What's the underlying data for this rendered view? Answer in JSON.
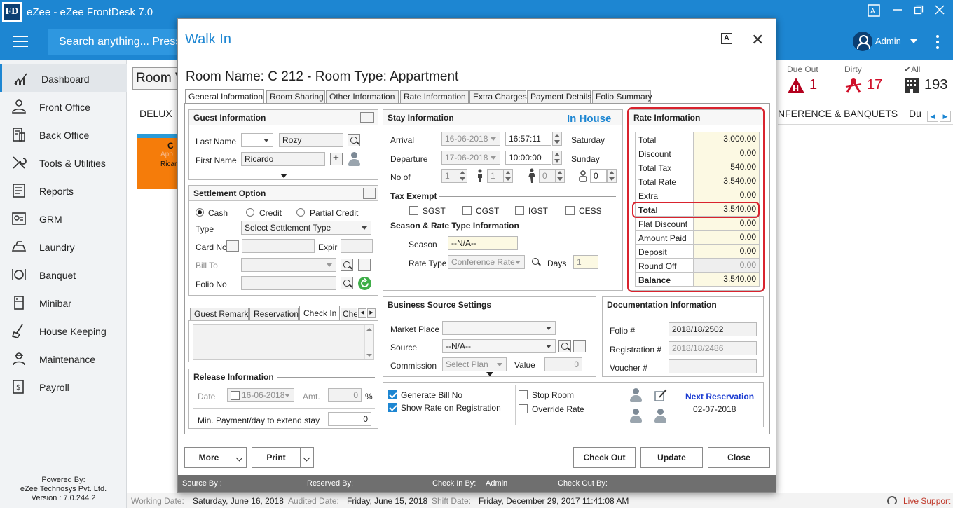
{
  "app": {
    "logo_text": "FD",
    "title": "eZee - eZee FrontDesk 7.0",
    "search_placeholder": "Search anything... Press",
    "user_name": "Admin"
  },
  "sidebar": {
    "items": [
      {
        "label": "Dashboard",
        "icon": "dashboard-icon"
      },
      {
        "label": "Front Office",
        "icon": "front-office-icon"
      },
      {
        "label": "Back Office",
        "icon": "back-office-icon"
      },
      {
        "label": "Tools & Utilities",
        "icon": "tools-icon"
      },
      {
        "label": "Reports",
        "icon": "reports-icon"
      },
      {
        "label": "GRM",
        "icon": "grm-icon"
      },
      {
        "label": "Laundry",
        "icon": "laundry-icon"
      },
      {
        "label": "Banquet",
        "icon": "banquet-icon"
      },
      {
        "label": "Minibar",
        "icon": "minibar-icon"
      },
      {
        "label": "House Keeping",
        "icon": "housekeeping-icon"
      },
      {
        "label": "Maintenance",
        "icon": "maintenance-icon"
      },
      {
        "label": "Payroll",
        "icon": "payroll-icon"
      }
    ],
    "powered_by": "Powered By:",
    "company": "eZee Technosys Pvt. Ltd.",
    "version": "Version : 7.0.244.2"
  },
  "background": {
    "room_view": "Room V",
    "tab_delux": "DELUX",
    "tab_conference": "NFERENCE & BANQUETS",
    "tab_du": "Du",
    "card_c": "C",
    "card_app": "App",
    "card_ricar": "Ricar",
    "due_out_label": "Due Out",
    "due_out_count": "1",
    "dirty_label": "Dirty",
    "dirty_count": "17",
    "all_label": "All",
    "all_count": "193"
  },
  "statusbar": {
    "working_label": "Working Date:",
    "working_value": "Saturday, June 16, 2018",
    "audited_label": "Audited Date:",
    "audited_value": "Friday, June 15, 2018",
    "shift_label": "Shift Date:",
    "shift_value": "Friday, December 29, 2017 11:41:08 AM",
    "live_support": "Live Support"
  },
  "dialog": {
    "title": "Walk In",
    "room_header": "Room Name: C 212 - Room Type: Appartment",
    "tabs": [
      "General Information",
      "Room Sharing",
      "Other Information",
      "Rate Information",
      "Extra Charges",
      "Payment Details",
      "Folio Summary"
    ],
    "guest": {
      "title": "Guest Information",
      "last_name_label": "Last Name",
      "last_name": "Rozy",
      "first_name_label": "First Name",
      "first_name": "Ricardo"
    },
    "settlement": {
      "title": "Settlement Option",
      "cash": "Cash",
      "credit": "Credit",
      "partial_credit": "Partial Credit",
      "type_label": "Type",
      "type_value": "Select Settlement Type",
      "card_no_label": "Card No",
      "expir_label": "Expir",
      "bill_to_label": "Bill To",
      "folio_no_label": "Folio No"
    },
    "remarks_tabs": [
      "Guest Remark",
      "Reservation",
      "Check In",
      "Che"
    ],
    "release": {
      "title": "Release Information",
      "date_label": "Date",
      "date_value": "16-06-2018",
      "amt_label": "Amt.",
      "amt_value": "0",
      "percent": "%",
      "min_payment_label": "Min. Payment/day to extend stay",
      "min_payment_value": "0"
    },
    "stay": {
      "title": "Stay Information",
      "status": "In House",
      "arrival_label": "Arrival",
      "arrival_date": "16-06-2018",
      "arrival_time": "16:57:11",
      "arrival_day": "Saturday",
      "departure_label": "Departure",
      "departure_date": "17-06-2018",
      "departure_time": "10:00:00",
      "departure_day": "Sunday",
      "no_of_label": "No of",
      "adults": "1",
      "children_a": "1",
      "children_b": "0",
      "infants": "0",
      "tax_exempt_title": "Tax Exempt",
      "sgst": "SGST",
      "cgst": "CGST",
      "igst": "IGST",
      "cess": "CESS",
      "season_title": "Season & Rate Type Information",
      "season_label": "Season",
      "season_value": "--N/A--",
      "rate_type_label": "Rate Type",
      "rate_type_value": "Conference Rate",
      "days_label": "Days",
      "days_value": "1"
    },
    "rate": {
      "title": "Rate Information",
      "rows": [
        {
          "label": "Total",
          "value": "3,000.00"
        },
        {
          "label": "Discount",
          "value": "0.00"
        },
        {
          "label": "Total Tax",
          "value": "540.00"
        },
        {
          "label": "Total Rate",
          "value": "3,540.00"
        },
        {
          "label": "Extra",
          "value": "0.00"
        },
        {
          "label": "Total",
          "value": "3,540.00"
        },
        {
          "label": "Flat Discount",
          "value": "0.00"
        },
        {
          "label": "Amount Paid",
          "value": "0.00"
        },
        {
          "label": "Deposit",
          "value": "0.00"
        },
        {
          "label": "Round Off",
          "value": "0.00"
        },
        {
          "label": "Balance",
          "value": "3,540.00"
        }
      ]
    },
    "business": {
      "title": "Business Source Settings",
      "market_place_label": "Market Place",
      "market_place_value": "",
      "source_label": "Source",
      "source_value": "--N/A--",
      "commission_label": "Commission",
      "commission_value": "Select Plan",
      "value_label": "Value",
      "value_value": "0"
    },
    "documentation": {
      "title": "Documentation Information",
      "folio_label": "Folio #",
      "folio_value": "2018/18/2502",
      "registration_label": "Registration #",
      "registration_value": "2018/18/2486",
      "voucher_label": "Voucher #",
      "voucher_value": ""
    },
    "options": {
      "generate_bill": "Generate Bill No",
      "show_rate": "Show Rate on Registration",
      "stop_room": "Stop Room",
      "override_rate": "Override Rate",
      "next_reservation_label": "Next Reservation",
      "next_reservation_date": "02-07-2018"
    },
    "buttons": {
      "more": "More",
      "print": "Print",
      "check_out": "Check Out",
      "update": "Update",
      "close": "Close"
    },
    "footer": {
      "source_by": "Source By :",
      "reserved_by": "Reserved By:",
      "check_in_by": "Check In By:",
      "check_in_by_value": "Admin",
      "check_out_by": "Check Out By:"
    }
  }
}
